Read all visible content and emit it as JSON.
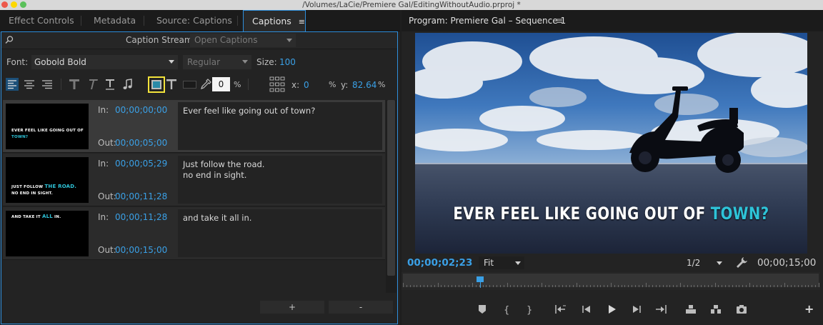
{
  "window": {
    "title": "/Volumes/LaCie/Premiere Gal/EditingWithoutAudio.prproj *"
  },
  "left_panel": {
    "tabs": [
      {
        "label": "Effect Controls"
      },
      {
        "label": "Metadata"
      },
      {
        "label": "Source: Captions"
      },
      {
        "label": "Captions",
        "active": true
      }
    ],
    "menu_glyph": "≡",
    "caption_stream": {
      "label": "Caption Stream:",
      "value": "Open Captions"
    },
    "font": {
      "label": "Font:",
      "family": "Gobold Bold",
      "style": "Regular",
      "size_label": "Size:",
      "size": "100"
    },
    "toolbar": {
      "opacity_value": "0",
      "percent": "%",
      "x_label": "x:",
      "x_value": "0",
      "y_label": "y:",
      "y_value": "82.64"
    },
    "captions": [
      {
        "in_label": "In:",
        "in": "00;00;00;00",
        "out_label": "Out:",
        "out": "00;00;05;00",
        "text": "Ever feel like going out of town?",
        "thumb_white": "EVER FEEL LIKE GOING OUT OF ",
        "thumb_cyan": "TOWN?",
        "thumb_rest": ""
      },
      {
        "in_label": "In:",
        "in": "00;00;05;29",
        "out_label": "Out:",
        "out": "00;00;11;28",
        "text": "Just follow the road.\nno end in sight.",
        "thumb_white": "JUST FOLLOW ",
        "thumb_cyan": "THE ROAD.",
        "thumb_rest": "NO END IN SIGHT."
      },
      {
        "in_label": "In:",
        "in": "00;00;11;28",
        "out_label": "Out:",
        "out": "00;00;15;00",
        "text": "and take it all in.",
        "thumb_white": "AND TAKE IT ",
        "thumb_cyan": "ALL",
        "thumb_rest": " IN."
      }
    ],
    "add_label": "+",
    "remove_label": "-"
  },
  "program_monitor": {
    "title": "Program: Premiere Gal – Sequence 1",
    "menu_glyph": "≡",
    "subtitle_white": "EVER FEEL LIKE GOING OUT OF ",
    "subtitle_cyan": "TOWN?",
    "current_timecode": "00;00;02;23",
    "zoom": "Fit",
    "resolution": "1/2",
    "duration": "00;00;15;00",
    "playhead_fraction": 0.186,
    "add_label": "+"
  },
  "colors": {
    "accent_blue": "#3aa0e6",
    "caption_cyan": "#2ec3d8",
    "highlight_yellow": "#f3e33b"
  }
}
